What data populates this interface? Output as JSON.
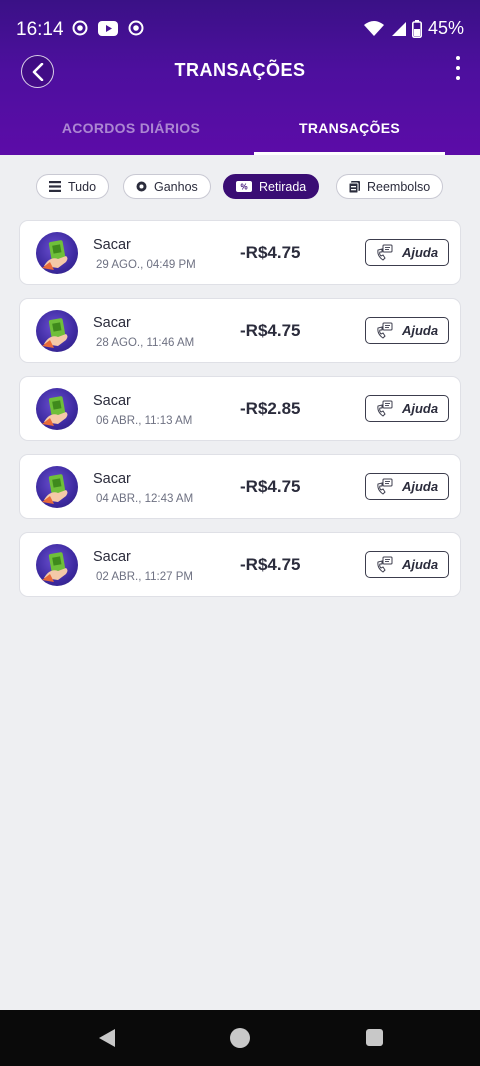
{
  "status_bar": {
    "time": "16:14",
    "battery": "45%"
  },
  "header": {
    "title": "TRANSAÇÕES"
  },
  "tabs": [
    {
      "label": "ACORDOS DIÁRIOS",
      "active": false
    },
    {
      "label": "TRANSAÇÕES",
      "active": true
    }
  ],
  "filters": [
    {
      "label": "Tudo",
      "icon": "list-icon",
      "active": false
    },
    {
      "label": "Ganhos",
      "icon": "coin-icon",
      "active": false
    },
    {
      "label": "Retirada",
      "icon": "cash-icon",
      "active": true
    },
    {
      "label": "Reembolso",
      "icon": "refund-icon",
      "active": false
    }
  ],
  "transactions": [
    {
      "title": "Sacar",
      "date": "29 AGO., 04:49 PM",
      "amount": "-R$4.75",
      "help_label": "Ajuda"
    },
    {
      "title": "Sacar",
      "date": "28 AGO., 11:46 AM",
      "amount": "-R$4.75",
      "help_label": "Ajuda"
    },
    {
      "title": "Sacar",
      "date": "06 ABR., 11:13 AM",
      "amount": "-R$2.85",
      "help_label": "Ajuda"
    },
    {
      "title": "Sacar",
      "date": "04 ABR., 12:43 AM",
      "amount": "-R$4.75",
      "help_label": "Ajuda"
    },
    {
      "title": "Sacar",
      "date": "02 ABR., 11:27 PM",
      "amount": "-R$4.75",
      "help_label": "Ajuda"
    }
  ],
  "colors": {
    "header_top": "#3a1186",
    "header_bottom": "#5c0ca8",
    "active_chip": "#3a0d74",
    "background": "#eeeff2"
  }
}
